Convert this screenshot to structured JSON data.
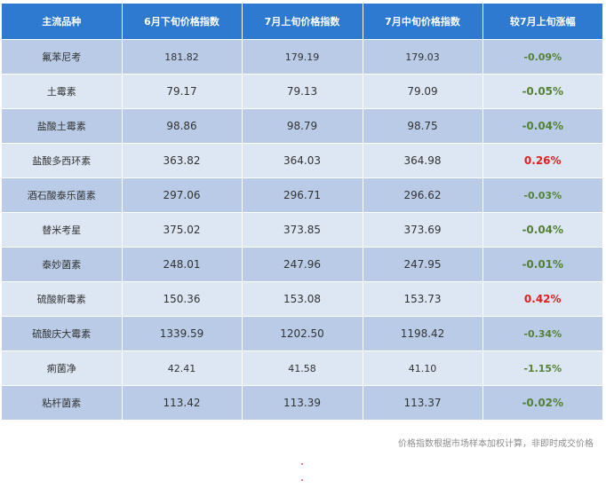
{
  "table": {
    "headers": [
      "主流品种",
      "6月下旬价格指数",
      "7月上旬价格指数",
      "7月中旬价格指数",
      "较7月上旬涨幅"
    ],
    "rows": [
      {
        "name": "氟苯尼考",
        "jun_late": "181.82",
        "jul_early": "179.19",
        "jul_mid": "179.03",
        "change": "-0.09%",
        "direction": "down"
      },
      {
        "name": "土霉素",
        "jun_late": "79.17",
        "jul_early": "79.13",
        "jul_mid": "79.09",
        "change": "-0.05%",
        "direction": "down"
      },
      {
        "name": "盐酸土霉素",
        "jun_late": "98.86",
        "jul_early": "98.79",
        "jul_mid": "98.75",
        "change": "-0.04%",
        "direction": "down"
      },
      {
        "name": "盐酸多西环素",
        "jun_late": "363.82",
        "jul_early": "364.03",
        "jul_mid": "364.98",
        "change": "0.26%",
        "direction": "up"
      },
      {
        "name": "酒石酸泰乐菌素",
        "jun_late": "297.06",
        "jul_early": "296.71",
        "jul_mid": "296.62",
        "change": "-0.03%",
        "direction": "down"
      },
      {
        "name": "替米考星",
        "jun_late": "375.02",
        "jul_early": "373.85",
        "jul_mid": "373.69",
        "change": "-0.04%",
        "direction": "down"
      },
      {
        "name": "泰妙菌素",
        "jun_late": "248.01",
        "jul_early": "247.96",
        "jul_mid": "247.95",
        "change": "-0.01%",
        "direction": "down"
      },
      {
        "name": "硫酸新霉素",
        "jun_late": "150.36",
        "jul_early": "153.08",
        "jul_mid": "153.73",
        "change": "0.42%",
        "direction": "up"
      },
      {
        "name": "硫酸庆大霉素",
        "jun_late": "1339.59",
        "jul_early": "1202.50",
        "jul_mid": "1198.42",
        "change": "-0.34%",
        "direction": "down"
      },
      {
        "name": "痢菌净",
        "jun_late": "42.41",
        "jul_early": "41.58",
        "jul_mid": "41.10",
        "change": "-1.15%",
        "direction": "down"
      },
      {
        "name": "粘杆菌素",
        "jun_late": "113.42",
        "jul_early": "113.39",
        "jul_mid": "113.37",
        "change": "-0.02%",
        "direction": "down"
      }
    ]
  },
  "footnote": "价格指数根据市场样本加权计算，非即时成交价格",
  "colors": {
    "header_bg": "#2e7ad1",
    "row_dark": "#b9cbe6",
    "row_light": "#dde6f3",
    "up": "#e02020",
    "down": "#548235"
  }
}
